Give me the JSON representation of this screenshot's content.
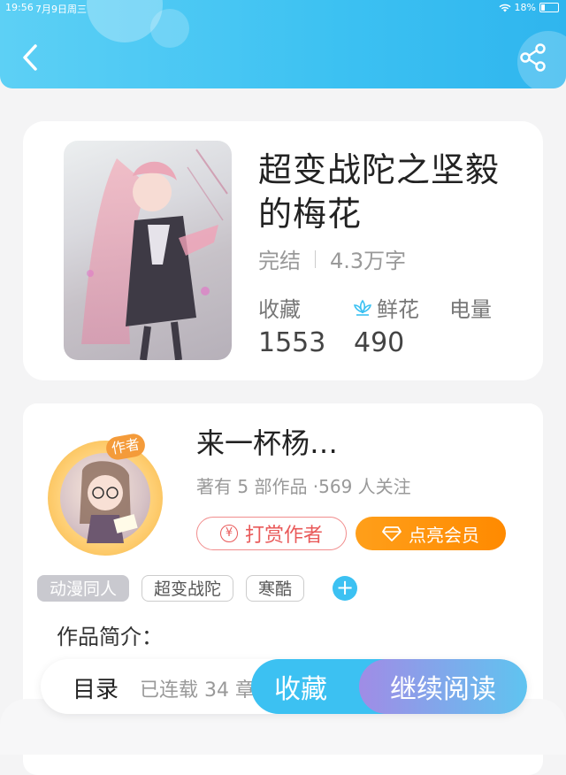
{
  "status_bar": {
    "time": "19:56",
    "date": "7月9日周三",
    "battery": "18%"
  },
  "header": {
    "back_icon": "chevron-left-icon",
    "share_icon": "share-icon"
  },
  "book": {
    "title": "超变战陀之坚毅的梅花",
    "status": "完结",
    "word_count": "4.3万字",
    "stats": {
      "favorites_label": "收藏",
      "flowers_label": "鲜花",
      "power_label": "电量",
      "favorites_value": "1553",
      "flowers_value": "490"
    }
  },
  "author": {
    "name": "来一杯杨…",
    "badge": "作者",
    "info": "著有 5 部作品 ·569 人关注",
    "tip_button": "打赏作者",
    "vip_button": "点亮会员"
  },
  "tags": [
    "动漫同人",
    "超变战陀",
    "寒酷"
  ],
  "intro_label": "作品简介：",
  "bottom_bar": {
    "catalog": "目录",
    "serial": "已连载 34 章",
    "collect": "收藏",
    "continue": "继续阅读"
  },
  "colors": {
    "accent": "#3cc1f2",
    "vip": "#ff9100",
    "tip": "#e95a5a"
  }
}
